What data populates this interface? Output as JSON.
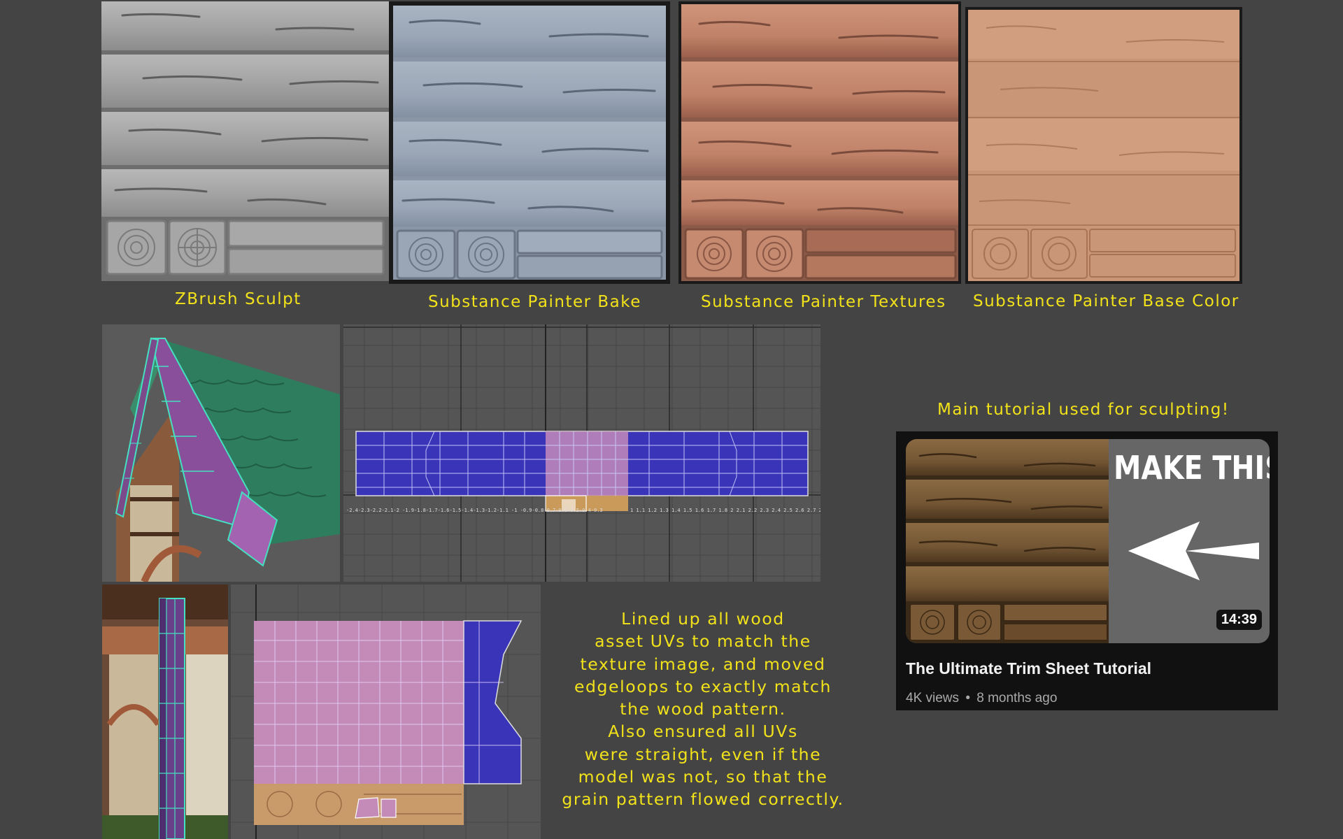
{
  "pipeline": {
    "stages": [
      {
        "caption": "ZBrush Sculpt",
        "style": "clay",
        "base_color": "#9a9a9a"
      },
      {
        "caption": "Substance Painter Bake",
        "style": "bake",
        "base_color": "#98a4b4"
      },
      {
        "caption": "Substance Painter Textures",
        "style": "textures",
        "base_color": "#c0836a"
      },
      {
        "caption": "Substance Painter Base Color",
        "style": "basecolor",
        "base_color": "#c79478"
      }
    ]
  },
  "uv_notes": {
    "lines": [
      "Lined up all wood",
      "asset UVs to match the",
      "texture image, and moved",
      "edgeloops to exactly match",
      "the wood pattern.",
      "Also ensured all UVs",
      "were straight, even if the",
      "model was not, so that the",
      "grain pattern flowed correctly."
    ]
  },
  "tutorial": {
    "heading": "Main tutorial used for sculpting!",
    "video": {
      "thumbnail_text": "MAKE THIS",
      "duration": "14:39",
      "title": "The Ultimate Trim Sheet Tutorial",
      "views": "4K views",
      "separator": "•",
      "age": "8 months ago"
    }
  },
  "colors": {
    "background": "#444444",
    "caption_yellow": "#f2e21a",
    "uv_blue": "#3a35b8",
    "uv_pink": "#c48ab8",
    "roof_green": "#2e7d5e",
    "wireframe_cyan": "#44e0c0"
  }
}
